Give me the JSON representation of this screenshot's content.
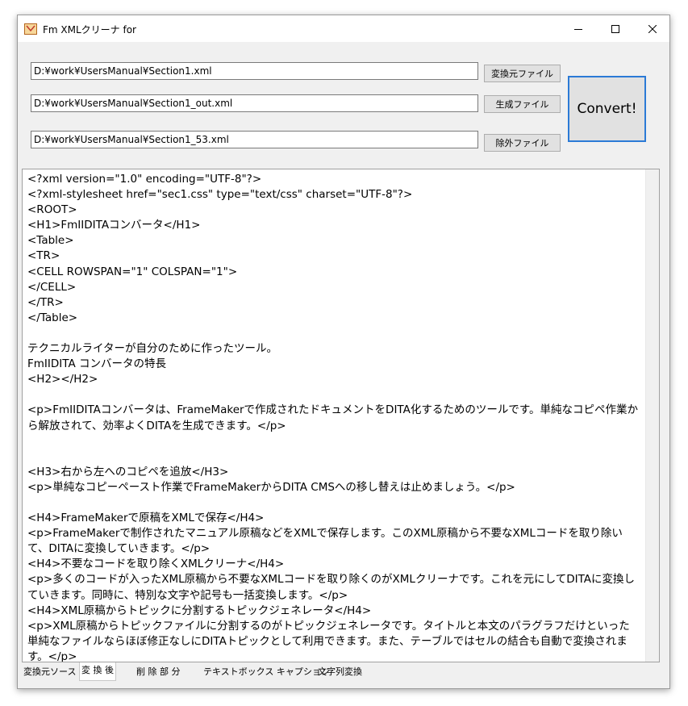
{
  "window": {
    "title": "Fm XMLクリーナ for"
  },
  "fields": {
    "source_path": "D:¥work¥UsersManual¥Section1.xml",
    "output_path": "D:¥work¥UsersManual¥Section1_out.xml",
    "exclude_path": "D:¥work¥UsersManual¥Section1_53.xml"
  },
  "buttons": {
    "source_file": "変換元ファイル",
    "output_file": "生成ファイル",
    "exclude_file": "除外ファイル",
    "convert": "Convert!"
  },
  "editor": {
    "content": "<?xml version=\"1.0\" encoding=\"UTF-8\"?>\n<?xml-stylesheet href=\"sec1.css\" type=\"text/css\" charset=\"UTF-8\"?>\n<ROOT>\n<H1>FmIIDITAコンバータ</H1>\n<Table>\n<TR>\n<CELL ROWSPAN=\"1\" COLSPAN=\"1\">\n</CELL>\n</TR>\n</Table>\n\nテクニカルライターが自分のために作ったツール。\nFmIIDITA コンバータの特長\n<H2></H2>\n\n<p>FmIIDITAコンバータは、FrameMakerで作成されたドキュメントをDITA化するためのツールです。単純なコピペ作業から解放されて、効率よくDITAを生成できます。</p>\n\n\n<H3>右から左へのコピペを追放</H3>\n<p>単純なコピーペースト作業でFrameMakerからDITA CMSへの移し替えは止めましょう。</p>\n\n<H4>FrameMakerで原稿をXMLで保存</H4>\n<p>FrameMakerで制作されたマニュアル原稿などをXMLで保存します。このXML原稿から不要なXMLコードを取り除いて、DITAに変換していきます。</p>\n<H4>不要なコードを取り除くXMLクリーナ</H4>\n<p>多くのコードが入ったXML原稿から不要なXMLコードを取り除くのがXMLクリーナです。これを元にしてDITAに変換していきます。同時に、特別な文字や記号も一括変換します。</p>\n<H4>XML原稿からトピックに分割するトピックジェネレータ</H4>\n<p>XML原稿からトピックファイルに分割するのがトピックジェネレータです。タイトルと本文のパラグラフだけといった単純なファイルならほぼ修正なしにDITAトピックとして利用できます。また、テーブルではセルの結合も自動で変換されます。</p>"
  },
  "tabs": [
    {
      "label": "変換元ソース",
      "active": false
    },
    {
      "label": "変 換 後",
      "active": true
    },
    {
      "label": "削 除 部 分",
      "active": false
    },
    {
      "label": "テキストボックス キャプション",
      "active": false
    },
    {
      "label": "文字列変換",
      "active": false
    }
  ]
}
